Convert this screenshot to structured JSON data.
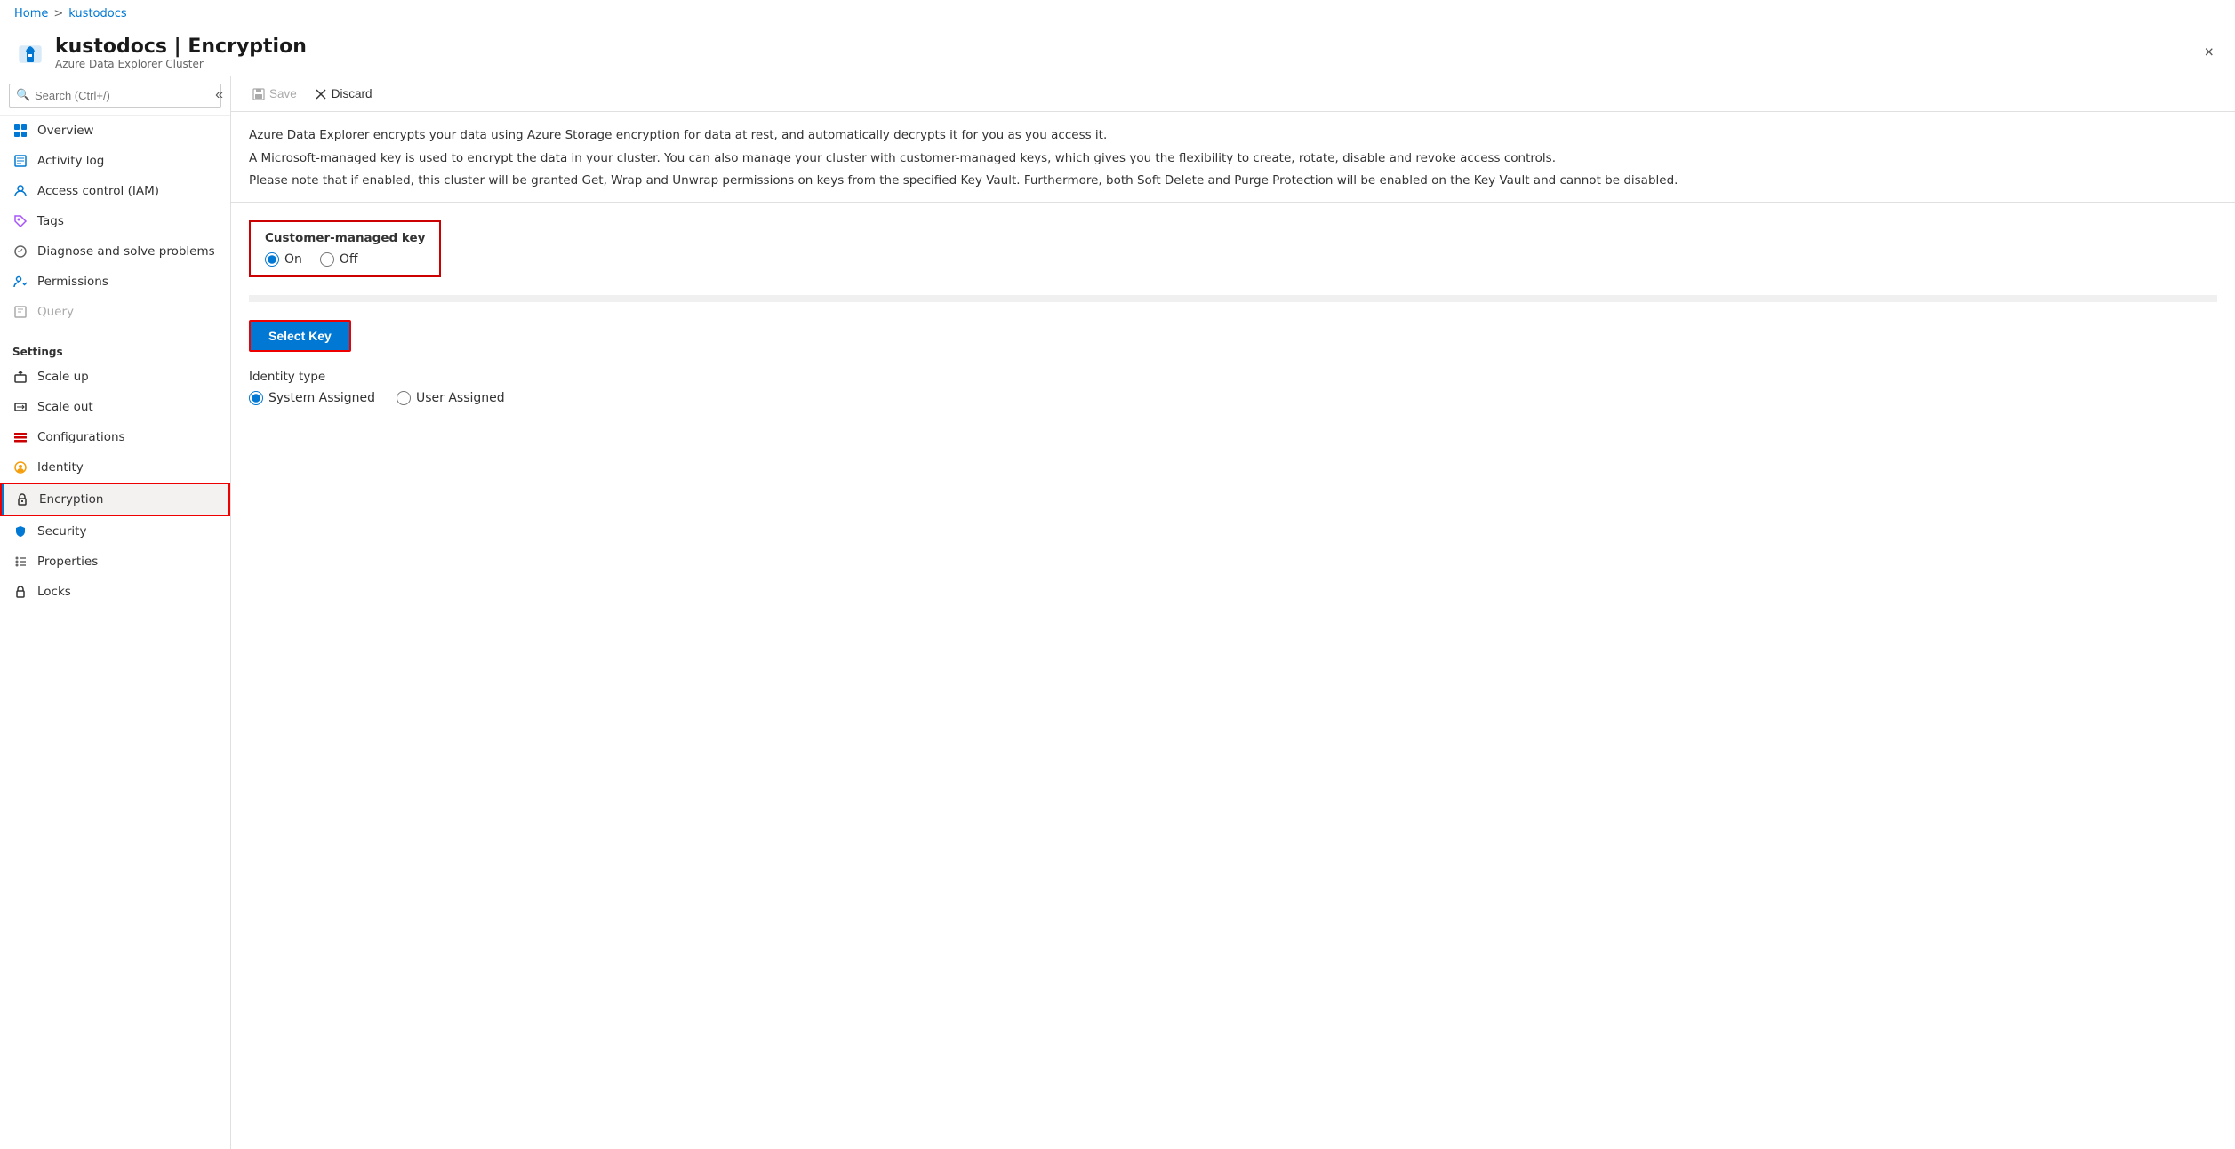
{
  "breadcrumb": {
    "home": "Home",
    "separator": ">",
    "current": "kustodocs"
  },
  "header": {
    "title": "kustodocs | Encryption",
    "subtitle": "Azure Data Explorer Cluster",
    "close_label": "×"
  },
  "sidebar": {
    "search_placeholder": "Search (Ctrl+/)",
    "collapse_icon": "«",
    "items": [
      {
        "id": "overview",
        "label": "Overview",
        "icon": "overview",
        "disabled": false
      },
      {
        "id": "activity-log",
        "label": "Activity log",
        "icon": "activity",
        "disabled": false
      },
      {
        "id": "access-control",
        "label": "Access control (IAM)",
        "icon": "access",
        "disabled": false
      },
      {
        "id": "tags",
        "label": "Tags",
        "icon": "tags",
        "disabled": false
      },
      {
        "id": "diagnose",
        "label": "Diagnose and solve problems",
        "icon": "diagnose",
        "disabled": false
      },
      {
        "id": "permissions",
        "label": "Permissions",
        "icon": "permissions",
        "disabled": false
      },
      {
        "id": "query",
        "label": "Query",
        "icon": "query",
        "disabled": true
      }
    ],
    "settings_label": "Settings",
    "settings_items": [
      {
        "id": "scale-up",
        "label": "Scale up",
        "icon": "scale-up"
      },
      {
        "id": "scale-out",
        "label": "Scale out",
        "icon": "scale-out"
      },
      {
        "id": "configurations",
        "label": "Configurations",
        "icon": "config"
      },
      {
        "id": "identity",
        "label": "Identity",
        "icon": "identity"
      },
      {
        "id": "encryption",
        "label": "Encryption",
        "icon": "encryption",
        "active": true
      },
      {
        "id": "security",
        "label": "Security",
        "icon": "security"
      },
      {
        "id": "properties",
        "label": "Properties",
        "icon": "properties"
      },
      {
        "id": "locks",
        "label": "Locks",
        "icon": "locks"
      }
    ]
  },
  "toolbar": {
    "save_label": "Save",
    "discard_label": "Discard"
  },
  "description": {
    "line1": "Azure Data Explorer encrypts your data using Azure Storage encryption for data at rest, and automatically decrypts it for you as you access it.",
    "line2": "A Microsoft-managed key is used to encrypt the data in your cluster. You can also manage your cluster with customer-managed keys, which gives you the flexibility to create, rotate, disable and revoke access controls.",
    "line3": "Please note that if enabled, this cluster will be granted Get, Wrap and Unwrap permissions on keys from the specified Key Vault. Furthermore, both Soft Delete and Purge Protection will be enabled on the Key Vault and cannot be disabled."
  },
  "customer_key": {
    "label": "Customer-managed key",
    "on_label": "On",
    "off_label": "Off",
    "selected": "on"
  },
  "select_key_button": "Select Key",
  "identity_type": {
    "label": "Identity type",
    "system_assigned": "System Assigned",
    "user_assigned": "User Assigned",
    "selected": "system"
  }
}
